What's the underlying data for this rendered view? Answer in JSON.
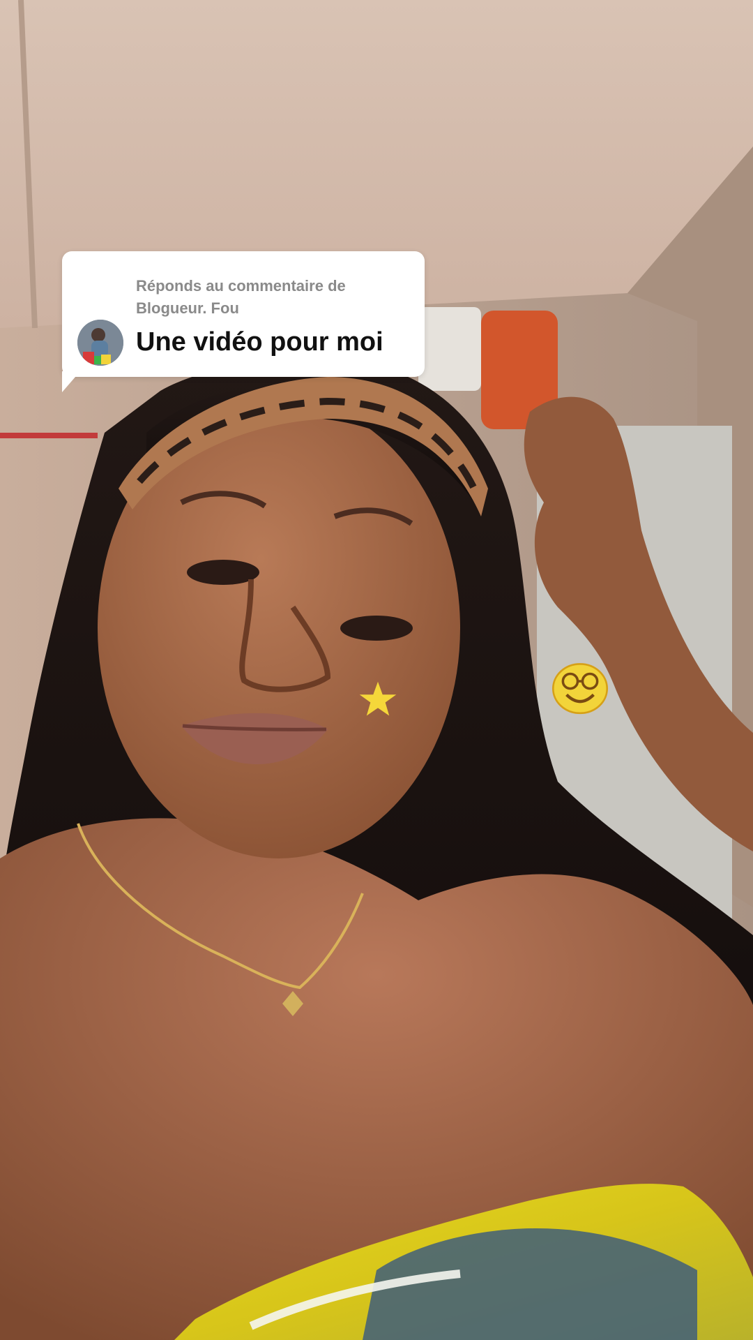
{
  "reply_card": {
    "header": "Réponds au commentaire de Blogueur. Fou",
    "comment": "Une vidéo pour moi"
  },
  "icons": {
    "commenter_avatar": "avatar-icon",
    "cheek_sticker": "star-icon",
    "face_sticker": "smiley-glasses-icon"
  },
  "colors": {
    "bubble_background": "#ffffff",
    "header_text": "#8a8a8a",
    "comment_text": "#111111",
    "star": "#f5d73a",
    "smiley": "#f2d43a"
  }
}
